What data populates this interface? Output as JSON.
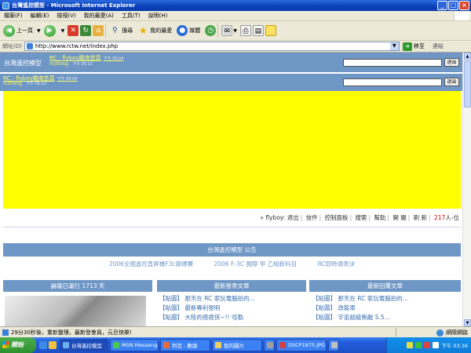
{
  "window": {
    "title": "台灣遙控模型 - Microsoft Internet Explorer",
    "buttons": {
      "minimize": "_",
      "maximize": "□",
      "close": "×"
    }
  },
  "menubar": [
    "檔案(F)",
    "編輯(E)",
    "檢視(V)",
    "我的最愛(A)",
    "工具(T)",
    "說明(H)"
  ],
  "toolbar": {
    "back_label": "上一頁",
    "search_label": "搜尋",
    "favorites_label": "我的最愛",
    "media_label": "媒體"
  },
  "addressbar": {
    "label": "網址(D)",
    "url": "http://www.rctw.net/index.php",
    "go_label": "移至",
    "links_label": "連結"
  },
  "page": {
    "site_title": "台灣遙控模型",
    "header_link": "RC : flyboy關南首頁",
    "header_time": "下午 05:04",
    "header_user": "rcchong",
    "header_user_time": "下午 05:12",
    "header2_link": "RC : flyboy關南首頁",
    "header2_time": "下午 05:04",
    "header2_user": "rcchong",
    "header2_user_time": "下午 05:12",
    "logout_label": "退出",
    "userbar": {
      "prefix": "»",
      "username": "flyboy:",
      "links": [
        "退出",
        "信件",
        "控制面板",
        "搜索",
        "幫助",
        "開 關",
        "刷 新"
      ],
      "online_count": "217",
      "online_suffix": "人-位"
    },
    "announce_title": "台灣遙控模型 公告",
    "announcements": [
      "2006全國遙控直昇機F3c錦標賽",
      "2006 F-3C 國際 甲 乙組新科目",
      "RC即時通表決"
    ],
    "columns": {
      "col1_title": "論壇已運行 1713 天",
      "col2_title": "最新發表文章",
      "col3_title": "最新回覆文章"
    },
    "latest_posts": [
      "【貼圖】 那天在 RC 家玩電腦拍的...",
      "【貼圖】 最新專利發明",
      "【貼圖】 大陸的痞痞侠~!! 哇勒"
    ],
    "latest_replies": [
      "【貼圖】 那天在 RC 家玩電腦拍的...",
      "【貼圖】 改裝車",
      "【貼圖】 宇宙超級無敵 S.5..."
    ]
  },
  "statusbar": {
    "text": "29分30秒後，重新整理，最新發會員，元旦快樂!",
    "zone": "網際網路"
  },
  "taskbar": {
    "start_label": "開始",
    "tasks": [
      "台灣遙控模型",
      "MSN Messenger",
      "判官 - 數路",
      "我的圖片",
      "",
      "DSCP1875.JPG -",
      ""
    ],
    "clock": "下午 03:36"
  }
}
